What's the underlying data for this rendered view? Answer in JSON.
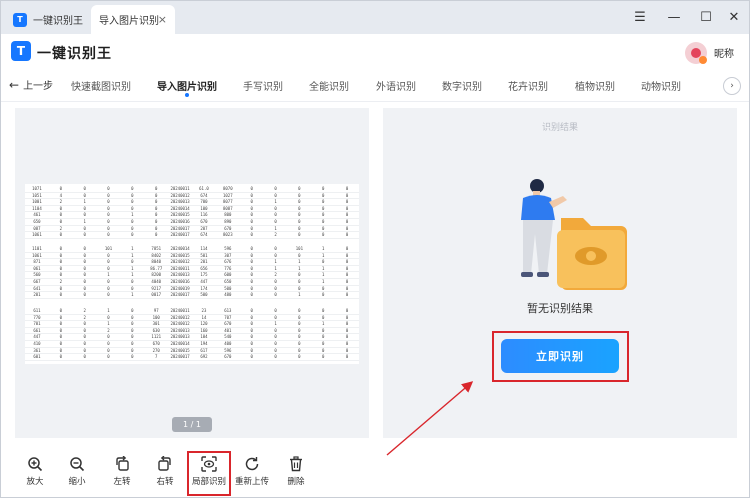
{
  "titlebar": {
    "tabs": [
      {
        "label": "一键识别王"
      },
      {
        "label": "导入图片识别",
        "close": "×"
      }
    ],
    "logo_letter": "T",
    "controls": {
      "menu": "☰",
      "minimize": "—",
      "maximize": "☐",
      "close": "✕"
    }
  },
  "header": {
    "logo_letter": "T",
    "app_name": "一键识别王",
    "user_name": "昵称"
  },
  "modes": {
    "back_label": "上一步",
    "back_arrow": "←",
    "items": [
      {
        "label": "快速截图识别"
      },
      {
        "label": "导入图片识别",
        "active": true
      },
      {
        "label": "手写识别"
      },
      {
        "label": "全能识别"
      },
      {
        "label": "外语识别"
      },
      {
        "label": "数字识别"
      },
      {
        "label": "花卉识别"
      },
      {
        "label": "植物识别"
      },
      {
        "label": "动物识别"
      }
    ],
    "more": "›"
  },
  "preview": {
    "pager": "1 / 1",
    "document_rows": [
      [
        "1071",
        "0",
        "0",
        "0",
        "0",
        "0",
        "20240011",
        "61.0",
        "8070",
        "0",
        "0",
        "0",
        "0",
        "0"
      ],
      [
        "1051",
        "4",
        "0",
        "0",
        "0",
        "0",
        "20240012",
        "674",
        "1027",
        "0",
        "0",
        "0",
        "0",
        "0"
      ],
      [
        "1001",
        "2",
        "1",
        "0",
        "0",
        "0",
        "20240013",
        "700",
        "8077",
        "0",
        "1",
        "0",
        "0",
        "0"
      ],
      [
        "1104",
        "0",
        "0",
        "0",
        "0",
        "0",
        "20240014",
        "100",
        "8087",
        "0",
        "0",
        "0",
        "0",
        "0"
      ],
      [
        "461",
        "0",
        "0",
        "0",
        "1",
        "0",
        "20240015",
        "116",
        "800",
        "0",
        "0",
        "0",
        "0",
        "0"
      ],
      [
        "650",
        "0",
        "1",
        "0",
        "0",
        "0",
        "20240016",
        "670",
        "890",
        "0",
        "0",
        "0",
        "0",
        "0"
      ],
      [
        "087",
        "2",
        "0",
        "0",
        "0",
        "0",
        "20240017",
        "207",
        "670",
        "0",
        "1",
        "0",
        "0",
        "0"
      ],
      [
        "1061",
        "0",
        "0",
        "0",
        "0",
        "0",
        "20240017",
        "674",
        "8023",
        "0",
        "2",
        "0",
        "0",
        "0"
      ]
    ],
    "document_rows_b": [
      [
        "1101",
        "0",
        "0",
        "101",
        "1",
        "7851",
        "20240014",
        "114",
        "596",
        "0",
        "0",
        "101",
        "1",
        "0"
      ],
      [
        "1061",
        "0",
        "0",
        "0",
        "1",
        "8402",
        "20240015",
        "501",
        "307",
        "0",
        "0",
        "0",
        "1",
        "0"
      ],
      [
        "871",
        "0",
        "0",
        "0",
        "0",
        "8040",
        "20240012",
        "201",
        "676",
        "0",
        "1",
        "1",
        "0",
        "0"
      ],
      [
        "061",
        "0",
        "0",
        "0",
        "1",
        "86.77",
        "20240011",
        "656",
        "776",
        "0",
        "1",
        "1",
        "1",
        "0"
      ],
      [
        "560",
        "0",
        "0",
        "1",
        "1",
        "8200",
        "20240013",
        "175",
        "600",
        "0",
        "2",
        "0",
        "1",
        "0"
      ],
      [
        "667",
        "2",
        "0",
        "0",
        "0",
        "4040",
        "20240016",
        "447",
        "650",
        "0",
        "0",
        "0",
        "1",
        "0"
      ],
      [
        "641",
        "0",
        "0",
        "0",
        "0",
        "9217",
        "20240019",
        "174",
        "500",
        "0",
        "0",
        "0",
        "0",
        "0"
      ],
      [
        "201",
        "0",
        "0",
        "0",
        "1",
        "0017",
        "20240017",
        "500",
        "480",
        "0",
        "0",
        "1",
        "0",
        "0"
      ]
    ],
    "document_rows_c": [
      [
        "611",
        "0",
        "2",
        "1",
        "0",
        "97",
        "20240011",
        "23",
        "613",
        "0",
        "0",
        "0",
        "0",
        "0"
      ],
      [
        "770",
        "0",
        "2",
        "0",
        "0",
        "100",
        "20240012",
        "14",
        "707",
        "0",
        "0",
        "0",
        "0",
        "0"
      ],
      [
        "701",
        "0",
        "0",
        "1",
        "0",
        "301",
        "20240012",
        "120",
        "670",
        "0",
        "1",
        "0",
        "1",
        "0"
      ],
      [
        "661",
        "0",
        "0",
        "2",
        "0",
        "630",
        "20240013",
        "160",
        "401",
        "0",
        "0",
        "0",
        "0",
        "0"
      ],
      [
        "447",
        "0",
        "0",
        "0",
        "0",
        "1121",
        "20240013",
        "104",
        "540",
        "0",
        "0",
        "0",
        "0",
        "0"
      ],
      [
        "410",
        "0",
        "0",
        "0",
        "0",
        "670",
        "20240014",
        "194",
        "400",
        "0",
        "0",
        "0",
        "0",
        "0"
      ],
      [
        "361",
        "0",
        "0",
        "0",
        "0",
        "270",
        "20240015",
        "617",
        "596",
        "0",
        "0",
        "0",
        "0",
        "0"
      ],
      [
        "601",
        "0",
        "0",
        "0",
        "0",
        "7",
        "20240017",
        "692",
        "670",
        "0",
        "0",
        "0",
        "0",
        "0"
      ]
    ]
  },
  "result": {
    "title": "识别结果",
    "empty_text": "暂无识别结果",
    "recognize_button": "立即识别"
  },
  "toolbar": {
    "items": [
      {
        "label": "放大",
        "icon": "zoom-in-icon"
      },
      {
        "label": "缩小",
        "icon": "zoom-out-icon"
      },
      {
        "label": "左转",
        "icon": "rotate-left-icon"
      },
      {
        "label": "右转",
        "icon": "rotate-right-icon"
      },
      {
        "label": "局部识别",
        "icon": "partial-recognize-icon"
      },
      {
        "label": "重新上传",
        "icon": "reupload-icon"
      },
      {
        "label": "删除",
        "icon": "trash-icon"
      }
    ]
  },
  "colors": {
    "accent": "#1677ff",
    "highlight_box": "#d9262c",
    "panel_bg": "#f0f2f5"
  }
}
